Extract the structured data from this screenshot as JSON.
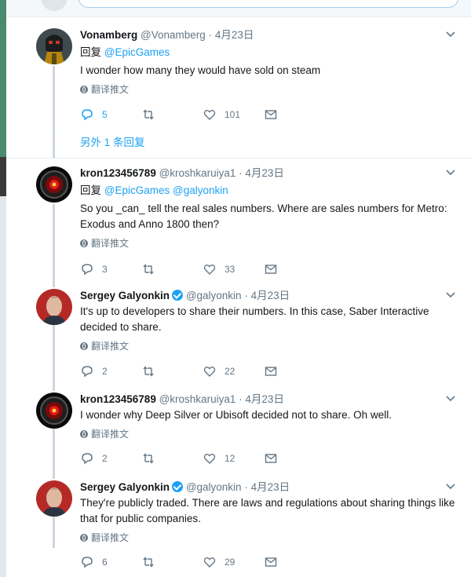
{
  "colors": {
    "accent": "#1da1f2",
    "muted": "#657786",
    "text": "#14171a"
  },
  "more_replies_label": "另外 1 条回复",
  "tweets": [
    {
      "name": "Vonamberg",
      "handle": "@Vonamberg",
      "dot": "·",
      "date": "4月23日",
      "reply_prefix": "回复",
      "mentions": "@EpicGames",
      "text": "I wonder how many they would have sold on steam",
      "translate": "翻译推文",
      "replies": "5",
      "retweets": "",
      "likes": "101",
      "avatar_icon": "helmet-avatar"
    },
    {
      "name": "kron123456789",
      "handle": "@kroshkaruiya1",
      "dot": "·",
      "date": "4月23日",
      "reply_prefix": "回复",
      "mentions": "@EpicGames @galyonkin",
      "text": "So you _can_ tell the real sales numbers. Where are sales numbers for Metro: Exodus and Anno 1800 then?",
      "translate": "翻译推文",
      "replies": "3",
      "retweets": "",
      "likes": "33",
      "avatar_icon": "hal-eye-avatar"
    },
    {
      "name": "Sergey Galyonkin",
      "handle": "@galyonkin",
      "dot": "·",
      "date": "4月23日",
      "text": "It's up to developers to share their numbers. In this case, Saber Interactive decided to share.",
      "translate": "翻译推文",
      "replies": "2",
      "retweets": "",
      "likes": "22",
      "avatar_icon": "portrait-avatar"
    },
    {
      "name": "kron123456789",
      "handle": "@kroshkaruiya1",
      "dot": "·",
      "date": "4月23日",
      "text": "I wonder why Deep Silver or Ubisoft decided not to share. Oh well.",
      "translate": "翻译推文",
      "replies": "2",
      "retweets": "",
      "likes": "12",
      "avatar_icon": "hal-eye-avatar"
    },
    {
      "name": "Sergey Galyonkin",
      "handle": "@galyonkin",
      "dot": "·",
      "date": "4月23日",
      "text": "They're publicly traded. There are laws and regulations about sharing things like that for public companies.",
      "translate": "翻译推文",
      "replies": "6",
      "retweets": "",
      "likes": "29",
      "avatar_icon": "portrait-avatar"
    }
  ]
}
